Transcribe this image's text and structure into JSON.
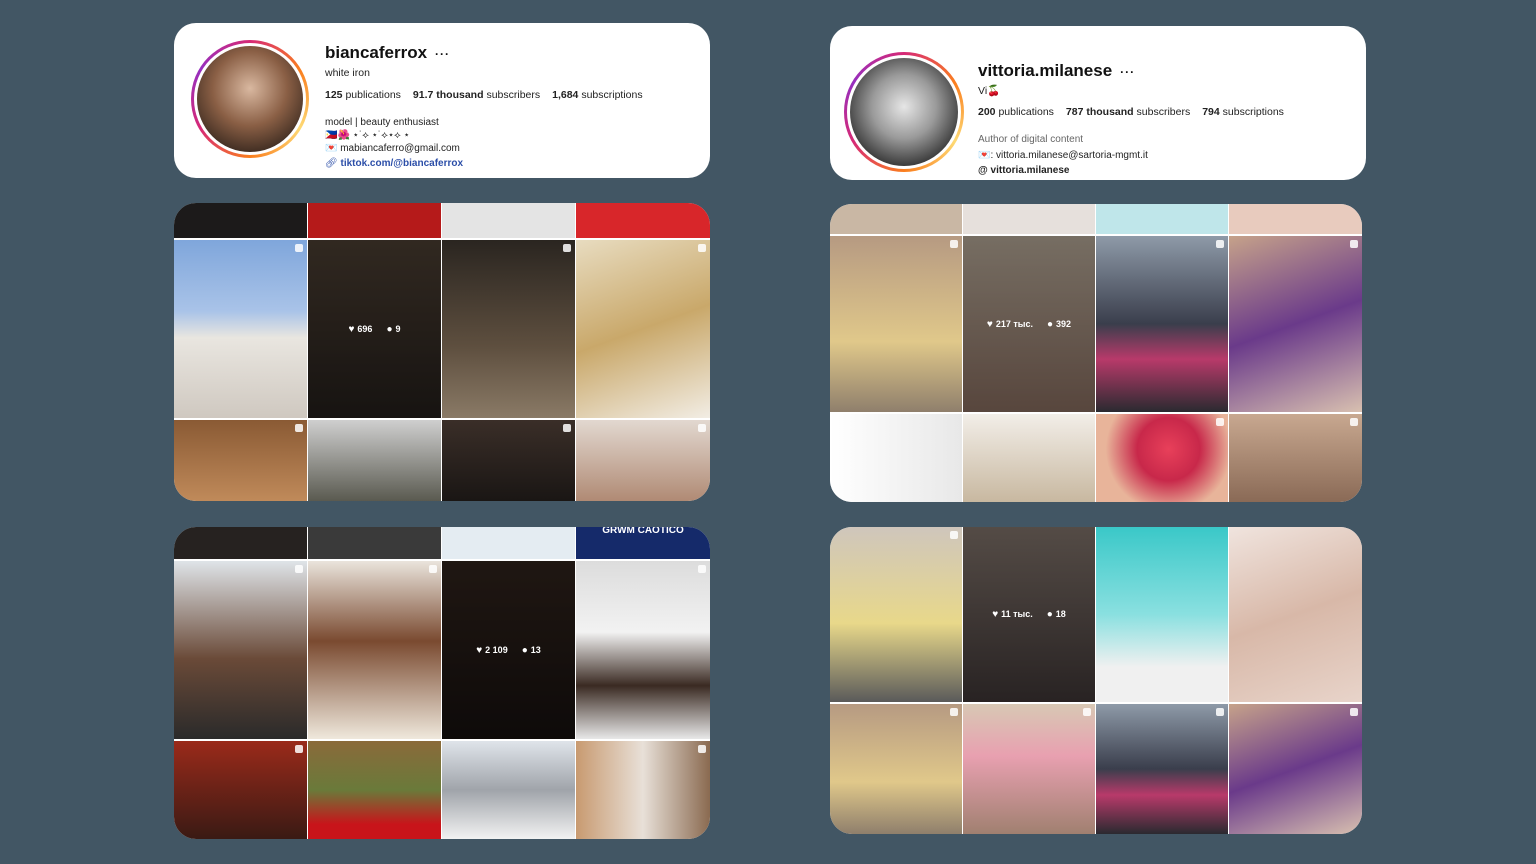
{
  "profiles": [
    {
      "username": "biancaferrox",
      "more": "···",
      "name": "white iron",
      "stats": [
        {
          "value": "125",
          "label": "publications"
        },
        {
          "value": "91.7 thousand",
          "label": "subscribers"
        },
        {
          "value": "1,684",
          "label": "subscriptions"
        }
      ],
      "bio": [
        "model | beauty enthusiast",
        "🇵🇭🌺 ⋆˙⟡ ⋆˙⟡⋆⟡ ⋆",
        "💌 mabiancaferro@gmail.com"
      ],
      "link_icon": "link-icon",
      "link": "tiktok.com/@biancaferrox"
    },
    {
      "username": "vittoria.milanese",
      "more": "···",
      "name": "Vi🍒",
      "stats": [
        {
          "value": "200",
          "label": "publications"
        },
        {
          "value": "787 thousand",
          "label": "subscribers"
        },
        {
          "value": "794",
          "label": "subscriptions"
        }
      ],
      "category": "Author of digital content",
      "bio": [
        "💌: vittoria.milanese@sartoria-mgmt.it"
      ],
      "threads": "vittoria.milanese"
    }
  ],
  "overlays": {
    "g1": {
      "likes": "696",
      "comments": "9"
    },
    "g2": {
      "likes": "217 тыс.",
      "comments": "392"
    },
    "g3": {
      "likes": "2 109",
      "comments": "13"
    },
    "g4": {
      "likes": "11 тыс.",
      "comments": "18"
    }
  },
  "overlay_texts": {
    "grwm": "GRWM CAOTICO"
  },
  "colors": {
    "background": "#425664",
    "link": "#2b4ea8"
  }
}
